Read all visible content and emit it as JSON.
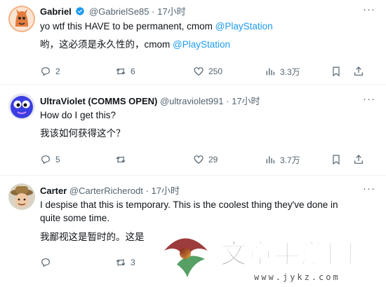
{
  "tweets": [
    {
      "name": "Gabriel",
      "handle": "@GabrielSe85",
      "dot": "·",
      "time": "17小时",
      "verified": true,
      "lines": [
        {
          "text": "yo wtf this HAVE to be permanent, cmom ",
          "mention": "@PlayStation"
        },
        {
          "text": "哟，这必须是永久性的，cmom ",
          "mention": "@PlayStation"
        }
      ],
      "stats": {
        "replies": "2",
        "reposts": "6",
        "likes": "250",
        "views": "3.3万"
      }
    },
    {
      "name": "UltraViolet (COMMS OPEN)",
      "handle": "@ultraviolet991",
      "dot": "·",
      "time": "17小时",
      "verified": false,
      "lines": [
        {
          "text": "How do I get this?"
        },
        {
          "text": "我该如何获得这个？"
        }
      ],
      "stats": {
        "replies": "5",
        "reposts": "",
        "likes": "29",
        "views": "3.7万"
      }
    },
    {
      "name": "Carter",
      "handle": "@CarterRicherodt",
      "dot": "·",
      "time": "17小时",
      "verified": false,
      "lines": [
        {
          "text": "I despise that this is temporary. This is the coolest thing they've done in"
        },
        {
          "text": "quite some time."
        },
        {
          "text": "我鄙视这是暂时的。这是"
        }
      ],
      "stats": {
        "replies": "",
        "reposts": "3",
        "likes": "",
        "views": ""
      }
    }
  ],
  "watermark": {
    "title": "文章手游网",
    "url": "www.jykz.com"
  },
  "colors": {
    "accent": "#1d9bf0",
    "muted": "#536471",
    "text": "#0f1419"
  },
  "icons": [
    "verified-badge-icon",
    "more-icon",
    "reply-icon",
    "repost-icon",
    "like-icon",
    "views-icon",
    "bookmark-icon",
    "share-icon"
  ]
}
